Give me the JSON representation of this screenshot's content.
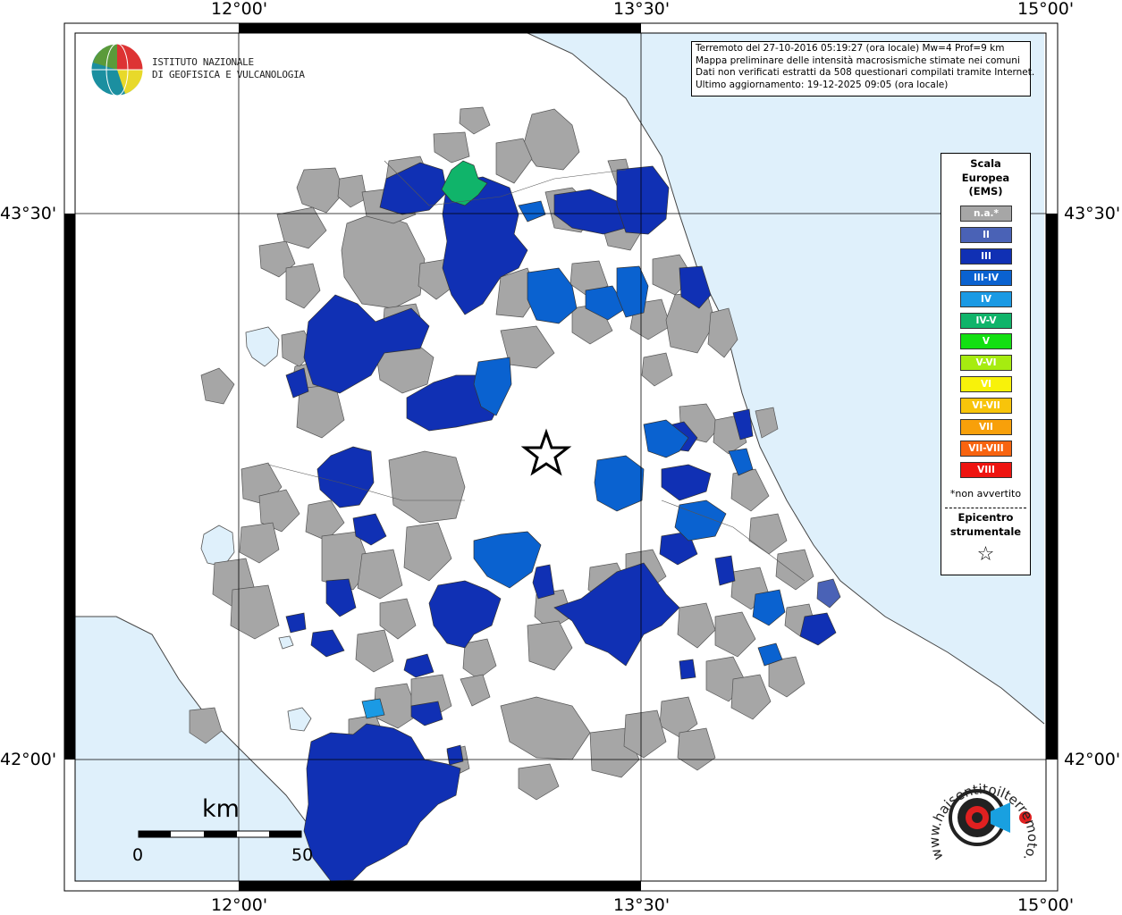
{
  "grid": {
    "top_labels": [
      "12°00'",
      "13°30'",
      "15°00'"
    ],
    "bottom_labels": [
      "12°00'",
      "13°30'",
      "15°00'"
    ],
    "left_labels": [
      "43°30'",
      "42°00'"
    ],
    "right_labels": [
      "43°30'",
      "42°00'"
    ]
  },
  "logo": {
    "line1": "ISTITUTO NAZIONALE",
    "line2": "DI GEOFISICA E VULCANOLOGIA"
  },
  "info": {
    "line1": "Terremoto del 27-10-2016 05:19:27 (ora locale) Mw=4 Prof=9 km",
    "line2": "Mappa preliminare delle intensità macrosismiche stimate nei comuni",
    "line3": "Dati non verificati estratti da 508 questionari compilati tramite Internet.",
    "line4": "Ultimo aggiornamento: 19-12-2025 09:05 (ora locale)"
  },
  "legend": {
    "title": "Scala Europea (EMS)",
    "title_lines": [
      "Scala",
      "Europea",
      "(EMS)"
    ],
    "items": [
      {
        "label": "n.a.*",
        "color": "#a6a6a6"
      },
      {
        "label": "II",
        "color": "#4a62b6"
      },
      {
        "label": "III",
        "color": "#1030b4"
      },
      {
        "label": "III-IV",
        "color": "#0a62d0"
      },
      {
        "label": "IV",
        "color": "#1b9ae4"
      },
      {
        "label": "IV-V",
        "color": "#10b46a"
      },
      {
        "label": "V",
        "color": "#13e012"
      },
      {
        "label": "V-VI",
        "color": "#a6ec10"
      },
      {
        "label": "VI",
        "color": "#f8f20a"
      },
      {
        "label": "VI-VII",
        "color": "#f8c40a"
      },
      {
        "label": "VII",
        "color": "#f8a00a"
      },
      {
        "label": "VII-VIII",
        "color": "#f86410"
      },
      {
        "label": "VIII",
        "color": "#ee1410"
      }
    ],
    "footnote": "*non avvertito",
    "epicenter_lines": [
      "Epicentro",
      "strumentale"
    ],
    "epicenter_symbol": "☆"
  },
  "scale_bar": {
    "unit": "km",
    "min_label": "0",
    "max_label": "50"
  },
  "watermark": {
    "text": "www.haisentitoilterremoto.it"
  },
  "colors": {
    "sea": "#dff0fb",
    "land": "#ffffff",
    "na": "#a6a6a6",
    "ems_ii": "#4a62b6",
    "ems_iii": "#1030b4",
    "ems_iii_iv": "#0a62d0",
    "ems_iv": "#1b9ae4",
    "ems_iv_v": "#10b46a"
  }
}
